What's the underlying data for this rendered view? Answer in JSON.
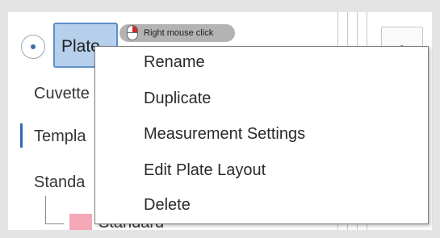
{
  "tree": {
    "plate_label": "Plate",
    "cuvette_label": "Cuvette",
    "template_label": "Templa",
    "standard_label": "Standa",
    "leaf_label": "Standard"
  },
  "up_button": {
    "label": "∧"
  },
  "tooltip": {
    "text": "Right mouse click",
    "icon": "mouse-right-click-icon"
  },
  "context_menu": {
    "items": [
      "Rename",
      "Duplicate",
      "Measurement Settings",
      "Edit Plate Layout",
      "Delete"
    ]
  },
  "colors": {
    "selection_fill": "#b6d0ec",
    "selection_border": "#5d8fc7",
    "mouse_button_red": "#d02b2b",
    "swatch_pink": "#f4a8b8"
  }
}
